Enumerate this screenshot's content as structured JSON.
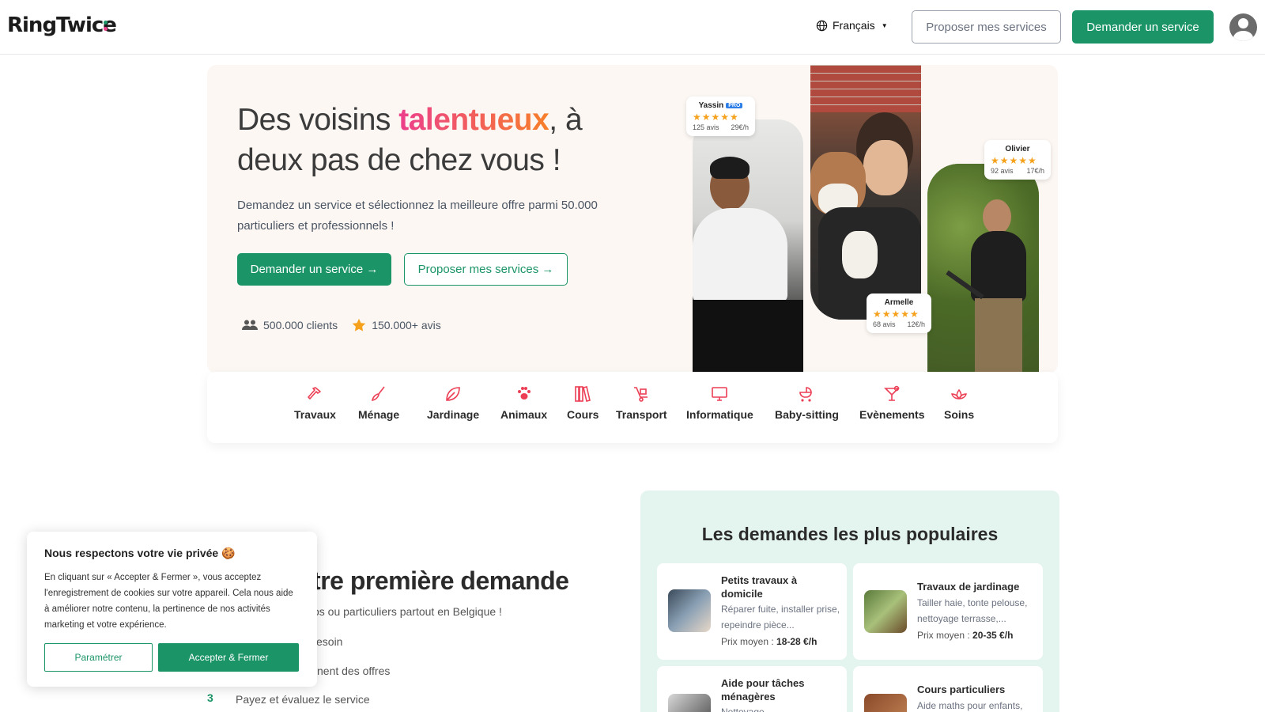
{
  "header": {
    "logo": "RingTwice",
    "language": "Français",
    "offer_services": "Proposer mes services",
    "request_service": "Demander un service"
  },
  "hero": {
    "title_before": "Des voisins ",
    "title_highlight": "talentueux",
    "title_after": ", à deux pas de chez vous !",
    "subtitle": "Demandez un service et sélectionnez la meilleure offre parmi 50.000 particuliers et professionnels !",
    "btn_request": "Demander un service →",
    "btn_offer": "Proposer mes services →",
    "stat_clients": "500.000 clients",
    "stat_reviews": "150.000+ avis"
  },
  "reviews": [
    {
      "name": "Yassin",
      "badge": "PRO",
      "stars": "★★★★★",
      "count": "125 avis",
      "price": "29€/h"
    },
    {
      "name": "Olivier",
      "badge": "",
      "stars": "★★★★★",
      "count": "92 avis",
      "price": "17€/h"
    },
    {
      "name": "Armelle",
      "badge": "",
      "stars": "★★★★★",
      "count": "68 avis",
      "price": "12€/h"
    }
  ],
  "categories": [
    {
      "label": "Travaux",
      "icon": "hammer-icon"
    },
    {
      "label": "Ménage",
      "icon": "broom-icon"
    },
    {
      "label": "Jardinage",
      "icon": "leaf-icon"
    },
    {
      "label": "Animaux",
      "icon": "paw-icon"
    },
    {
      "label": "Cours",
      "icon": "books-icon"
    },
    {
      "label": "Transport",
      "icon": "dolly-icon"
    },
    {
      "label": "Informatique",
      "icon": "monitor-icon"
    },
    {
      "label": "Baby-sitting",
      "icon": "stroller-icon"
    },
    {
      "label": "Evènements",
      "icon": "cocktail-icon"
    },
    {
      "label": "Soins",
      "icon": "lotus-icon"
    }
  ],
  "section": {
    "title_partial": "otre première demande",
    "subtitle_partial": "os ou particuliers partout en Belgique !",
    "step1_partial": "esoin",
    "step2_partial": "nent des offres",
    "step3_num": "3",
    "step3": "Payez et évaluez le service"
  },
  "popular": {
    "title": "Les demandes les plus populaires",
    "price_label": "Prix moyen : ",
    "cards": [
      {
        "title": "Petits travaux à domicile",
        "desc": "Réparer fuite, installer prise, repeindre pièce...",
        "price": "18-28 €/h"
      },
      {
        "title": "Travaux de jardinage",
        "desc": "Tailler haie, tonte pelouse, nettoyage terrasse,...",
        "price": "20-35 €/h"
      },
      {
        "title": "Aide pour tâches ménagères",
        "desc": "Nettoyage...",
        "price": ""
      },
      {
        "title": "Cours particuliers",
        "desc": "Aide maths pour enfants,",
        "price": ""
      }
    ]
  },
  "cookie": {
    "title": "Nous respectons votre vie privée 🍪",
    "body": "En cliquant sur « Accepter & Fermer », vous acceptez l'enregistrement de cookies sur votre appareil. Cela nous aide à améliorer notre contenu, la pertinence de nos activités marketing et votre expérience.",
    "settings": "Paramétrer",
    "accept": "Accepter & Fermer"
  },
  "colors": {
    "brand_green": "#1b9467",
    "accent_pink": "#ec3f8c",
    "accent_orange": "#f77f2a",
    "hero_bg": "#fcf7f3",
    "popular_bg": "#e4f4ee"
  }
}
